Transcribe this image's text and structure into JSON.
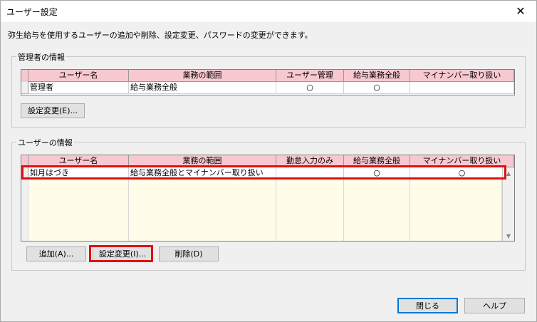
{
  "window": {
    "title": "ユーザー設定",
    "close_glyph": "✕"
  },
  "description": "弥生給与を使用するユーザーの追加や削除、設定変更、パスワードの変更ができます。",
  "admin": {
    "group_label": "管理者の情報",
    "columns": [
      "ユーザー名",
      "業務の範囲",
      "ユーザー管理",
      "給与業務全般",
      "マイナンバー取り扱い"
    ],
    "rows": [
      {
        "name": "管理者",
        "scope": "給与業務全般",
        "user_admin": "○",
        "payroll": "○",
        "mynumber": ""
      }
    ],
    "settings_button": "設定変更(E)..."
  },
  "users": {
    "group_label": "ユーザーの情報",
    "columns": [
      "ユーザー名",
      "業務の範囲",
      "勤怠入力のみ",
      "給与業務全般",
      "マイナンバー取り扱い"
    ],
    "rows": [
      {
        "name": "如月はづき",
        "scope": "給与業務全般とマイナンバー取り扱い",
        "attendance_only": "",
        "payroll": "○",
        "mynumber": "○"
      }
    ],
    "add_button": "追加(A)...",
    "settings_button": "設定変更(I)...",
    "delete_button": "削除(D)"
  },
  "footer": {
    "close_button": "閉じる",
    "help_button": "ヘルプ"
  },
  "colors": {
    "header_pink": "#f8c8d0",
    "row_fill": "#fffcea",
    "highlight": "#e01010",
    "default_button_border": "#0078d7"
  }
}
